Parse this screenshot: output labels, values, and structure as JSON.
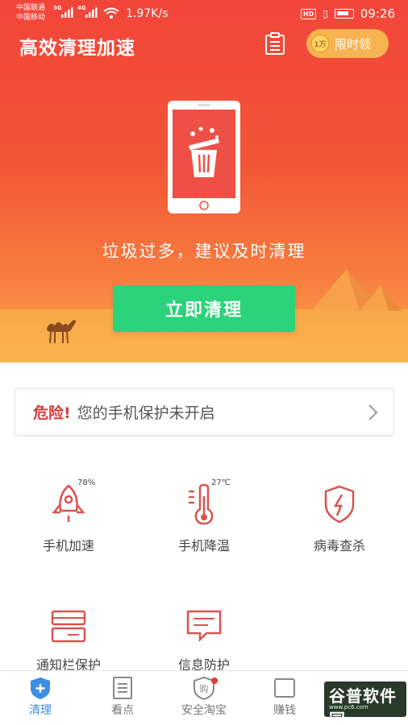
{
  "status_bar": {
    "carrier1": "中国联通",
    "carrier2": "中国移动",
    "network1": "3G",
    "network2": "4G",
    "speed": "1.97K/s",
    "hd_badge": "HD",
    "time": "09:26"
  },
  "header": {
    "title": "高效清理加速",
    "promo_coin": "1万",
    "promo_text": "限时领"
  },
  "hero": {
    "message": "垃圾过多，建议及时清理",
    "clean_button": "立即清理"
  },
  "warning": {
    "label": "危险!",
    "text": "您的手机保护未开启"
  },
  "features": [
    {
      "label": "手机加速",
      "badge": "78%",
      "icon": "rocket-icon"
    },
    {
      "label": "手机降温",
      "badge": "27℃",
      "icon": "thermometer-icon"
    },
    {
      "label": "病毒查杀",
      "badge": "",
      "icon": "shield-lightning-icon"
    },
    {
      "label": "通知栏保护",
      "badge": "",
      "icon": "notification-bar-icon"
    },
    {
      "label": "信息防护",
      "badge": "",
      "icon": "message-icon"
    }
  ],
  "tabs": [
    {
      "label": "清理",
      "icon": "shield-plus-icon",
      "active": true
    },
    {
      "label": "看点",
      "icon": "document-icon",
      "active": false
    },
    {
      "label": "安全淘宝",
      "icon": "shield-shop-icon",
      "active": false
    },
    {
      "label": "赚钱",
      "icon": "money-icon",
      "active": false
    }
  ],
  "watermark": {
    "main": "谷普软件园",
    "sub": "www.pc6.com"
  },
  "colors": {
    "hero_red": "#f2453a",
    "clean_green": "#2bd37a",
    "danger_red": "#d93b3b",
    "tab_active_blue": "#3a8ee6",
    "icon_red": "#d9534f"
  }
}
